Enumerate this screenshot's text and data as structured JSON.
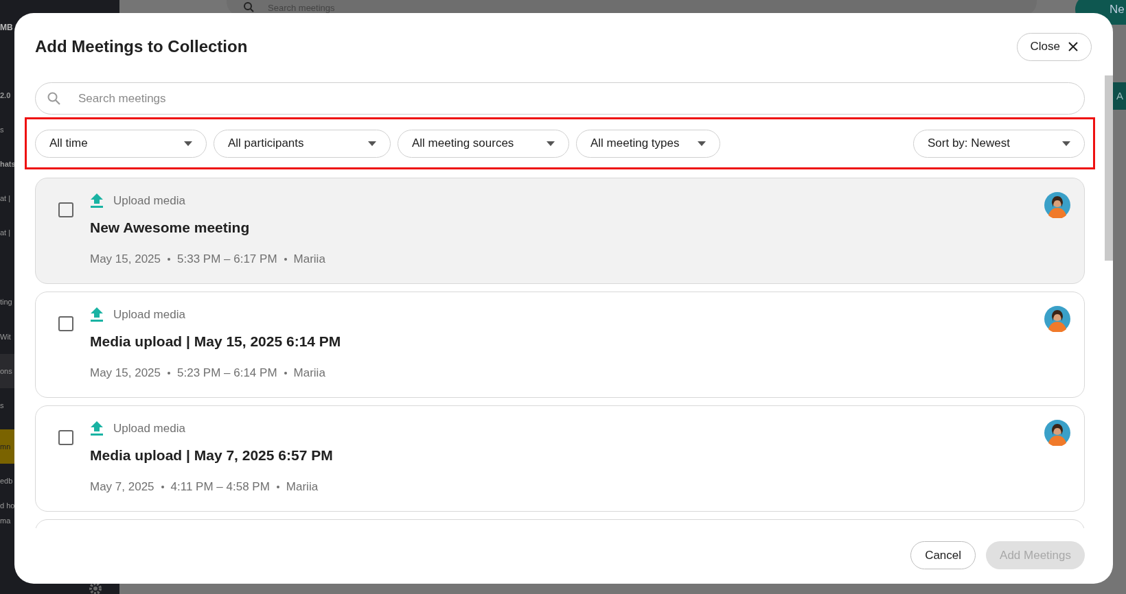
{
  "backdrop": {
    "logo_fragment": "MB",
    "search_placeholder": "Search meetings",
    "new_button": "Ne",
    "side_tab": "A",
    "sidebar_items": [
      {
        "label": "2.0",
        "kind": "bold"
      },
      {
        "label": "s",
        "kind": "plain"
      },
      {
        "label": "hats",
        "kind": "bold"
      },
      {
        "label": "at |",
        "kind": "plain"
      },
      {
        "label": "at |",
        "kind": "plain"
      },
      {
        "label": "ting",
        "kind": "gap"
      },
      {
        "label": "Wit",
        "kind": "plain"
      },
      {
        "label": "ons",
        "kind": "active"
      },
      {
        "label": "s",
        "kind": "plain"
      },
      {
        "label": "mn",
        "kind": "promo"
      },
      {
        "label": "edb",
        "kind": "plain"
      },
      {
        "label": "d ho",
        "kind": "tight"
      },
      {
        "label": "ma",
        "kind": "tight"
      }
    ]
  },
  "dialog": {
    "title": "Add Meetings to Collection",
    "close_button": "Close",
    "search": {
      "placeholder": "Search meetings"
    },
    "filters": [
      {
        "label": "All time"
      },
      {
        "label": "All participants"
      },
      {
        "label": "All meeting sources"
      },
      {
        "label": "All meeting types"
      }
    ],
    "sort": {
      "label": "Sort by: Newest"
    },
    "meetings": [
      {
        "source": "Upload media",
        "title": "New Awesome meeting",
        "date": "May 15, 2025",
        "time": "5:33 PM – 6:17 PM",
        "owner": "Mariia",
        "checked": false,
        "highlighted": true
      },
      {
        "source": "Upload media",
        "title": "Media upload | May 15, 2025 6:14 PM",
        "date": "May 15, 2025",
        "time": "5:23 PM – 6:14 PM",
        "owner": "Mariia",
        "checked": false,
        "highlighted": false
      },
      {
        "source": "Upload media",
        "title": "Media upload | May 7, 2025 6:57 PM",
        "date": "May 7, 2025",
        "time": "4:11 PM – 4:58 PM",
        "owner": "Mariia",
        "checked": false,
        "highlighted": false
      }
    ],
    "buttons": [
      {
        "label": "Cancel",
        "disabled": false
      },
      {
        "label": "Add Meetings",
        "disabled": true
      }
    ]
  }
}
